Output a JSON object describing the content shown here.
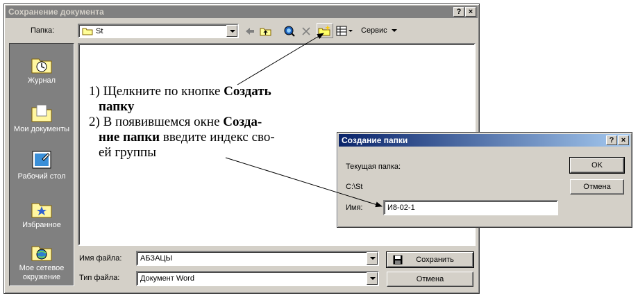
{
  "save_dialog": {
    "title": "Сохранение документа",
    "help_btn": "?",
    "close_btn": "×",
    "folder_label": "Папка:",
    "folder_value": "St",
    "service_label": "Сервис",
    "places": [
      {
        "label": "Журнал",
        "icon": "history-icon"
      },
      {
        "label": "Мои документы",
        "icon": "my-documents-icon"
      },
      {
        "label": "Рабочий стол",
        "icon": "desktop-icon"
      },
      {
        "label": "Избранное",
        "icon": "favorites-icon"
      },
      {
        "label_line1": "Мое сетевое",
        "label_line2": "окружение",
        "icon": "network-icon"
      }
    ],
    "filename_label": "Имя файла:",
    "filename_value": "АБЗАЦЫ",
    "filetype_label": "Тип файла:",
    "filetype_value": "Документ Word",
    "save_label": "Сохранить",
    "cancel_label": "Отмена"
  },
  "new_folder_dialog": {
    "title": "Создание папки",
    "help_btn": "?",
    "close_btn": "×",
    "current_label": "Текущая папка:",
    "current_path": "C:\\St",
    "name_label": "Имя:",
    "name_value": "И8-02-1",
    "ok_label": "OK",
    "cancel_label": "Отмена"
  },
  "annotation": {
    "l1a": "1) Щелкните по кнопке ",
    "l1b": "Создать",
    "l2": "папку",
    "l3a": "2) В появившемся окне ",
    "l3b": "Созда-",
    "l4a": "ние папки",
    "l4b": " введите индекс сво-",
    "l5": "ей группы"
  }
}
